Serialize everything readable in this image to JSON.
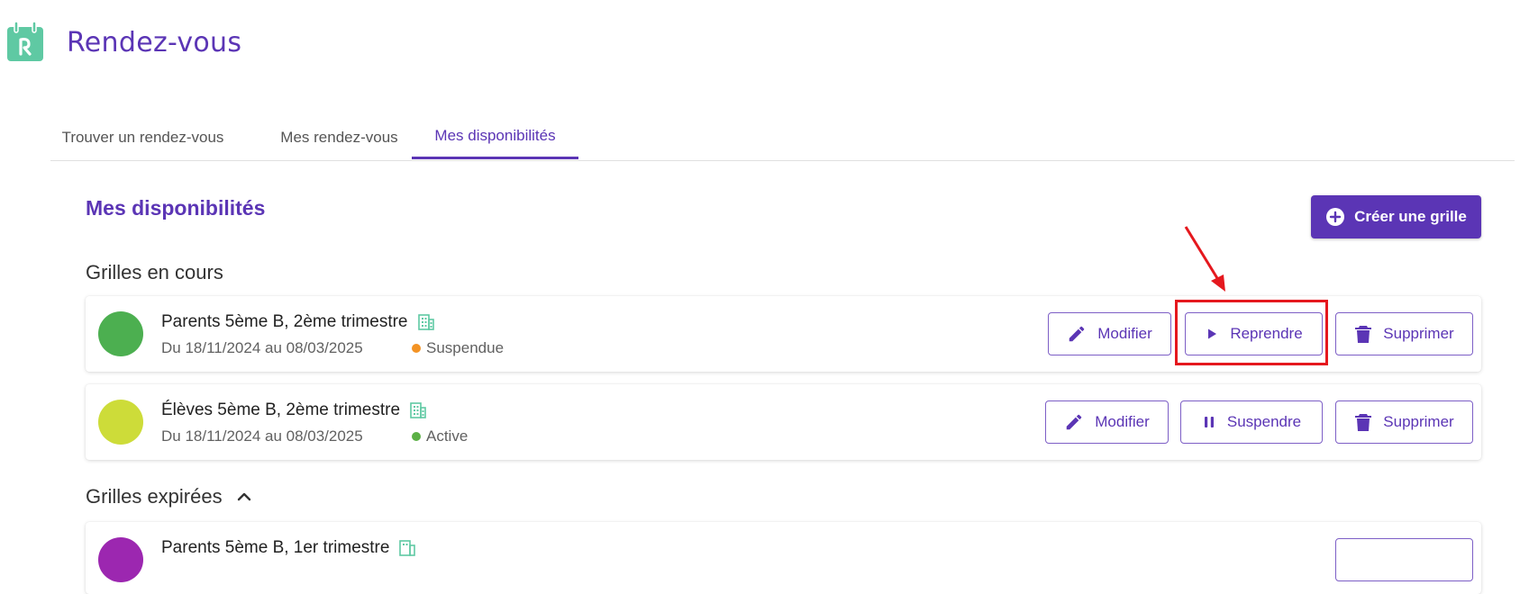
{
  "app": {
    "title": "Rendez-vous"
  },
  "tabs": [
    {
      "label": "Trouver un rendez-vous",
      "active": false
    },
    {
      "label": "Mes rendez-vous",
      "active": false
    },
    {
      "label": "Mes disponibilités",
      "active": true
    }
  ],
  "page": {
    "title": "Mes disponibilités",
    "create_button": "Créer une grille"
  },
  "sections": {
    "current_title": "Grilles en cours",
    "expired_title": "Grilles expirées"
  },
  "grids": [
    {
      "name": "Parents 5ème B, 2ème trimestre",
      "dates": "Du 18/11/2024 au 08/03/2025",
      "status": "Suspendue",
      "status_color": "#f39324",
      "dot_color": "#4caf50",
      "actions": [
        "Modifier",
        "Reprendre",
        "Supprimer"
      ]
    },
    {
      "name": "Élèves 5ème B, 2ème trimestre",
      "dates": "Du 18/11/2024 au 08/03/2025",
      "status": "Active",
      "status_color": "#5bb045",
      "dot_color": "#cddc39",
      "actions": [
        "Modifier",
        "Suspendre",
        "Supprimer"
      ]
    }
  ],
  "expired_grids": [
    {
      "name": "Parents 5ème B, 1er trimestre",
      "dot_color": "#9c27b0"
    }
  ],
  "colors": {
    "accent": "#5b35b5",
    "logo": "#5fc9a3",
    "highlight": "#e5181e"
  },
  "icons": [
    "calendar-logo-icon",
    "building-icon",
    "pencil-icon",
    "play-icon",
    "pause-icon",
    "trash-icon",
    "plus-circle-icon",
    "chevron-up-icon"
  ]
}
